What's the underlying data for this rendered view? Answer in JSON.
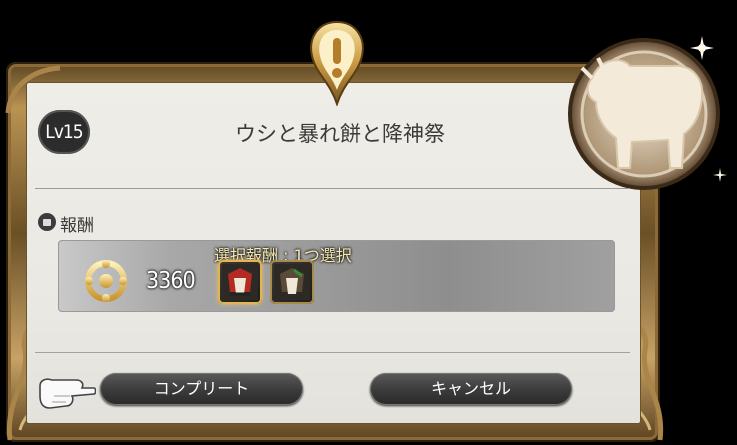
{
  "quest": {
    "level_badge": "Lv15",
    "title": "ウシと暴れ餅と降神祭"
  },
  "rewards": {
    "section_label": "報酬",
    "gil_amount": "3360",
    "selection_label": "選択報酬 : 1つ選択",
    "items": [
      {
        "icon": "armor-item-icon",
        "selected": true
      },
      {
        "icon": "armor-item-icon",
        "selected": false
      }
    ]
  },
  "buttons": {
    "complete_label": "コンプリート",
    "cancel_label": "キャンセル"
  },
  "icons": {
    "quest_marker": "exclamation-quest-icon",
    "zodiac": "cow-icon",
    "cursor": "pointing-hand-cursor-icon",
    "currency": "gil-icon"
  },
  "colors": {
    "frame_gold": "#b99352",
    "panel_bg": "#ebe9e3",
    "text_dark": "#3a3a3a",
    "selection_text": "#f5e8b0"
  }
}
